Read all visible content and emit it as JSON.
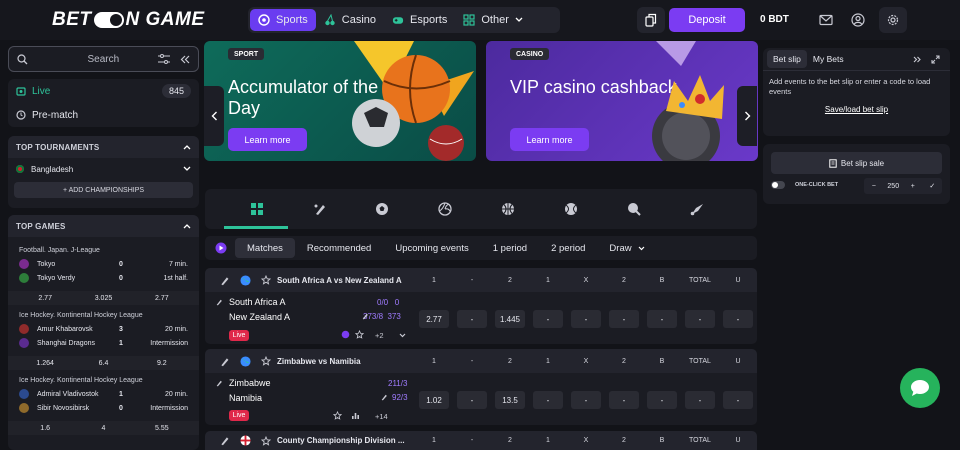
{
  "header": {
    "logo_left": "BET",
    "logo_right": "N GAME",
    "nav": [
      {
        "label": "Sports",
        "icon": "soccer-ball-icon"
      },
      {
        "label": "Casino",
        "icon": "cherries-icon"
      },
      {
        "label": "Esports",
        "icon": "gamepad-icon"
      },
      {
        "label": "Other",
        "icon": "grid-icon"
      }
    ],
    "deposit_label": "Deposit",
    "balance": "0 BDT"
  },
  "sidebar": {
    "search_placeholder": "Search",
    "live_label": "Live",
    "live_count": "845",
    "prematch_label": "Pre-match",
    "top_tournaments_title": "TOP TOURNAMENTS",
    "tournament": "Bangladesh",
    "add_championships": "+ ADD CHAMPIONSHIPS",
    "top_games_title": "TOP GAMES",
    "games": [
      {
        "league": "Football. Japan. J-League",
        "teams": [
          {
            "name": "Tokyo",
            "score": "0",
            "info": "7 min."
          },
          {
            "name": "Tokyo Verdy",
            "score": "0",
            "info": "1st half."
          }
        ],
        "odds": [
          "2.77",
          "3.025",
          "2.77"
        ]
      },
      {
        "league": "Ice Hockey. Kontinental Hockey League",
        "teams": [
          {
            "name": "Amur Khabarovsk",
            "score": "3",
            "info": "20 min."
          },
          {
            "name": "Shanghai Dragons",
            "score": "1",
            "info": "Intermission"
          }
        ],
        "odds": [
          "1.264",
          "6.4",
          "9.2"
        ]
      },
      {
        "league": "Ice Hockey. Kontinental Hockey League",
        "teams": [
          {
            "name": "Admiral Vladivostok",
            "score": "1",
            "info": "20 min."
          },
          {
            "name": "Sibir Novosibirsk",
            "score": "0",
            "info": "Intermission"
          }
        ],
        "odds": [
          "1.6",
          "4",
          "5.55"
        ]
      }
    ]
  },
  "banners": [
    {
      "tag": "SPORT",
      "title": "Accumulator of the Day",
      "button": "Learn more"
    },
    {
      "tag": "CASINO",
      "title": "VIP casino cashback",
      "button": "Learn more"
    }
  ],
  "filters": [
    "Matches",
    "Recommended",
    "Upcoming events",
    "1 period",
    "2 period",
    "Draw"
  ],
  "columns": [
    "1",
    "-",
    "2",
    "1",
    "X",
    "2",
    "B",
    "TOTAL",
    "U"
  ],
  "matches": [
    {
      "title": "South Africa A vs New Zealand A",
      "team1": "South Africa A",
      "team2": "New Zealand A",
      "score1": "0/0   0",
      "score2": "373/8  373",
      "live": "Live",
      "more": "+2",
      "odds": [
        "2.77",
        "-",
        "1.445",
        "-",
        "-",
        "-",
        "-",
        "-",
        "-"
      ]
    },
    {
      "title": "Zimbabwe vs Namibia",
      "team1": "Zimbabwe",
      "team2": "Namibia",
      "score1": "211/3",
      "score2": "92/3",
      "live": "Live",
      "more": "+14",
      "odds": [
        "1.02",
        "-",
        "13.5",
        "-",
        "-",
        "-",
        "-",
        "-",
        "-"
      ]
    },
    {
      "title": "County Championship Division ..."
    }
  ],
  "betslip": {
    "tab_active": "Bet slip",
    "tab_other": "My Bets",
    "message": "Add events to the bet slip or enter a code to load events",
    "load_link": "Save/load bet slip",
    "sale_button": "Bet slip sale",
    "one_click": "ONE-CLICK BET",
    "stake": "250"
  },
  "colors": {
    "accent": "#7b3cf2",
    "live": "#e0284a",
    "chat": "#26b35c",
    "sport_selected": "#2ec39a"
  }
}
